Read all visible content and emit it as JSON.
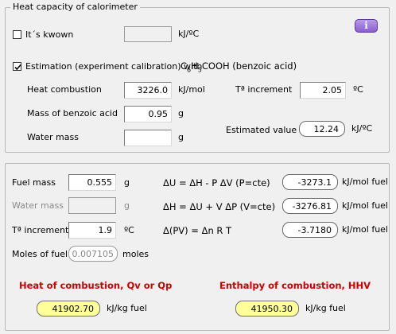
{
  "calorimeter": {
    "group_title": "Heat capacity of calorimeter",
    "known_label": "It´s kwown",
    "known_checked": false,
    "known_value": "",
    "known_unit": "kJ/ºC",
    "info_label": "i",
    "estimation_label": "Estimation (experiment calibration) with",
    "estimation_checked": true,
    "formula_prefix": "C",
    "formula_sub1": "6",
    "formula_mid": "H",
    "formula_sub2": "5",
    "formula_suffix": "COOH (benzoic acid)",
    "heat_combustion_label": "Heat combustion",
    "heat_combustion_value": "3226.0",
    "heat_combustion_unit": "kJ/mol",
    "t_increment_label": "Tª increment",
    "t_increment_value": "2.05",
    "t_increment_unit": "ºC",
    "mass_benzoic_label": "Mass of benzoic acid",
    "mass_benzoic_value": "0.95",
    "mass_benzoic_unit": "g",
    "water_mass_label": "Water mass",
    "water_mass_value": "",
    "water_mass_unit": "g",
    "estimated_label": "Estimated value",
    "estimated_value": "12.24",
    "estimated_unit": "kJ/ºC"
  },
  "fuel": {
    "fuel_mass_label": "Fuel mass",
    "fuel_mass_value": "0.555",
    "fuel_mass_unit": "g",
    "water_mass_label": "Water mass",
    "water_mass_value": "",
    "water_mass_unit": "g",
    "t_increment_label": "Tª increment",
    "t_increment_value": "1.9",
    "t_increment_unit": "ºC",
    "moles_label": "Moles of fuel",
    "moles_value": "0.007105",
    "moles_unit": "moles",
    "du_label": "ΔU = ΔH - P ΔV (P=cte)",
    "du_value": "-3273.1",
    "du_unit": "kJ/mol fuel",
    "dh_label": "ΔH = ΔU + V ΔP (V=cte)",
    "dh_value": "-3276.81",
    "dh_unit": "kJ/mol fuel",
    "dpv_label": "Δ(PV) = Δn R T",
    "dpv_value": "-3.7180",
    "dpv_unit": "kJ/mol fuel",
    "heat_title": "Heat of combustion, Qv or Qp",
    "heat_value": "41902.70",
    "heat_unit": "kJ/kg fuel",
    "hhv_title": "Enthalpy of combustion, HHV",
    "hhv_value": "41950.30",
    "hhv_unit": "kJ/kg fuel"
  }
}
